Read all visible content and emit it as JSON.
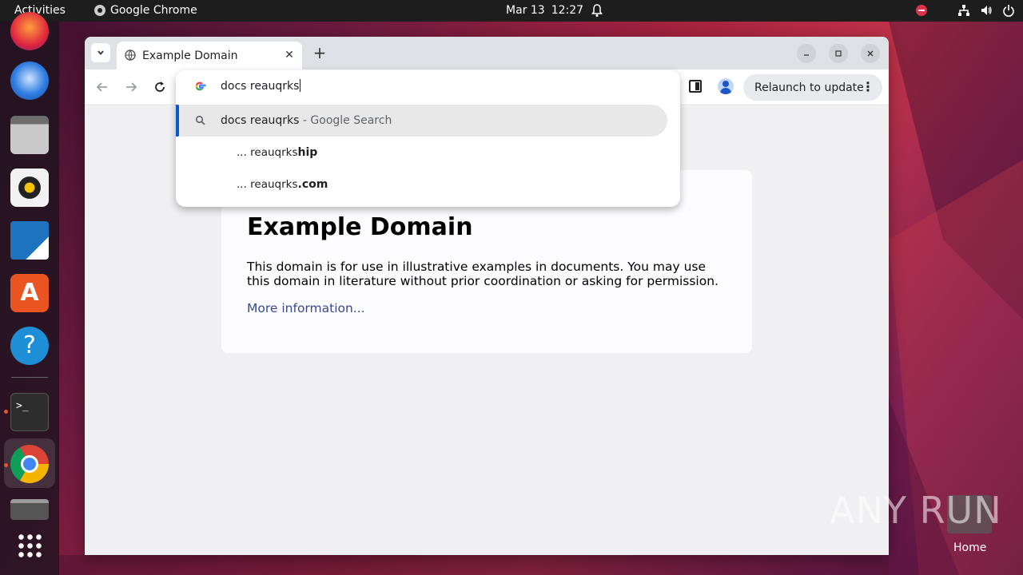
{
  "topbar": {
    "activities": "Activities",
    "app_name": "Google Chrome",
    "date": "Mar 13",
    "time": "12:27"
  },
  "dock": {
    "items": [
      "firefox-icon",
      "thunderbird-icon",
      "files-icon",
      "rhythmbox-icon",
      "writer-icon",
      "app-center-icon",
      "help-icon",
      "terminal-icon",
      "chrome-icon",
      "trash-icon",
      "show-apps-icon"
    ]
  },
  "browser": {
    "tab_title": "Example Domain",
    "tab_close": "✕",
    "new_tab": "+",
    "relaunch_label": "Relaunch to update",
    "omnibox": {
      "input_value": "docs reauqrks",
      "suggestions": [
        {
          "main": "docs reauqrks",
          "sub": " - Google Search"
        },
        {
          "prefix": "... reauqrks",
          "suffix": "hip"
        },
        {
          "prefix": "... reauqrks",
          "suffix": ".com"
        }
      ]
    }
  },
  "page": {
    "heading": "Example Domain",
    "paragraph": "This domain is for use in illustrative examples in documents. You may use this domain in literature without prior coordination or asking for permission.",
    "link": "More information..."
  },
  "desktop": {
    "home_label": "Home",
    "watermark": "ANY RUN"
  },
  "colors": {
    "accent": "#e95420",
    "link": "#38488f",
    "selection_bar": "#0b57d0"
  }
}
